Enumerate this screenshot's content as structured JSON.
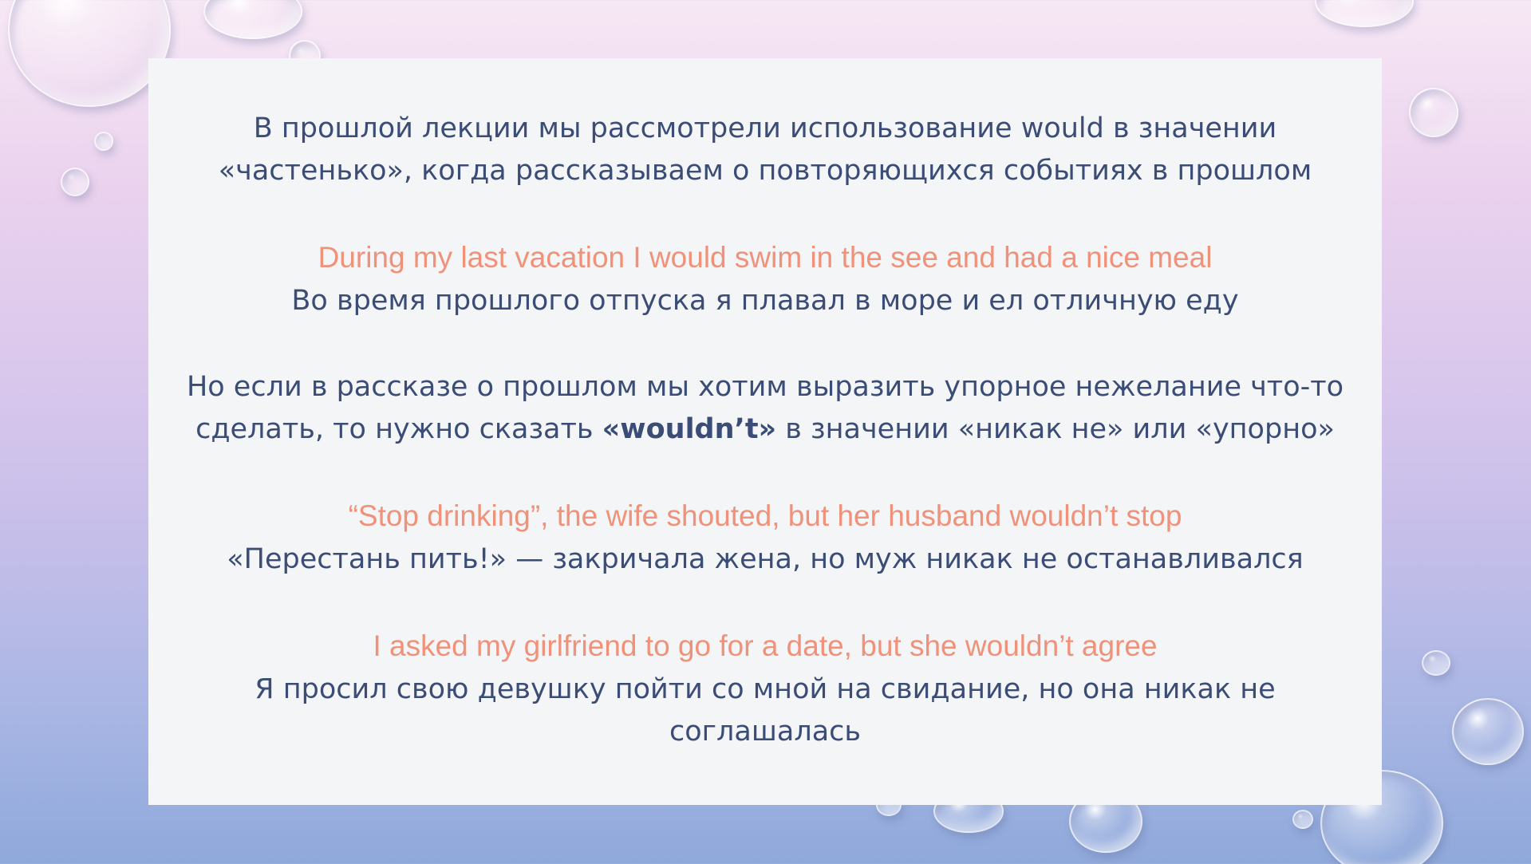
{
  "slide": {
    "p1_line1": "В прошлой лекции мы рассмотрели использование would в значении",
    "p1_line2": "«частенько», когда рассказываем о повторяющихся событиях в прошлом",
    "ex1_en": "During my last vacation I would swim in the see and had a nice meal",
    "ex1_ru": "Во время прошлого отпуска я плавал в море и ел отличную еду",
    "p2_line1": "Но если в рассказе о прошлом мы хотим выразить упорное нежелание что-то",
    "p2_line2_pre": "сделать, то нужно сказать ",
    "p2_line2_bold": "«wouldn’t»",
    "p2_line2_post": " в значении «никак не» или «упорно»",
    "ex2_en": "“Stop drinking”, the wife shouted, but her husband wouldn’t stop",
    "ex2_ru": "«Перестань пить!» — закричала жена, но муж никак не останавливался",
    "ex3_en": "I asked my girlfriend to go for a date, but she wouldn’t agree",
    "ex3_ru_line1": "Я просил свою девушку пойти со мной на свидание, но она никак не",
    "ex3_ru_line2": "соглашалась"
  },
  "colors": {
    "russian_text": "#3b4d76",
    "english_text": "#f0917a",
    "card_background": "#f4f5f7"
  }
}
